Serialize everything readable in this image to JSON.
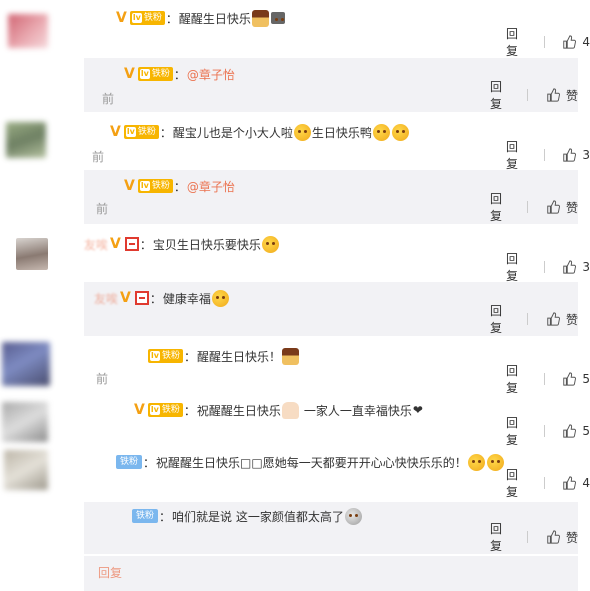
{
  "comments": [
    {
      "name": "",
      "badges": [
        "v",
        "fan"
      ],
      "fan_label": "铁粉",
      "text": "醒醒生日快乐",
      "emoji": [
        "cake-emoji",
        "family-emoji"
      ],
      "reply_label": "回复",
      "like_count": "4"
    },
    {
      "name": "",
      "badges": [
        "v",
        "fan"
      ],
      "fan_label": "铁粉",
      "mention": "@章子怡",
      "time": "前",
      "reply_label": "回复",
      "like_label": "赞"
    },
    {
      "name": "",
      "badges": [
        "v",
        "fan"
      ],
      "fan_label": "铁粉",
      "text": "醒宝儿也是个小大人啦",
      "text2": "生日快乐鸭",
      "time": "前",
      "reply_label": "回复",
      "like_count": "3"
    },
    {
      "name": "",
      "badges": [
        "v",
        "fan"
      ],
      "fan_label": "铁粉",
      "mention": "@章子怡",
      "time": "前",
      "reply_label": "回复",
      "like_label": "赞"
    },
    {
      "name": "友唉",
      "badges": [
        "v",
        "red"
      ],
      "text": "宝贝生日快乐要快乐",
      "reply_label": "回复",
      "like_count": "3"
    },
    {
      "name": "友唉",
      "badges": [
        "v",
        "red"
      ],
      "text": "健康幸福",
      "reply_label": "回复",
      "like_label": "赞"
    },
    {
      "name": "",
      "badges": [
        "fan"
      ],
      "fan_label": "铁粉",
      "text": "醒醒生日快乐！",
      "time": "前",
      "reply_label": "回复",
      "like_count": "5"
    },
    {
      "name": "",
      "badges": [
        "v",
        "fan"
      ],
      "fan_label": "铁粉",
      "text": "祝醒醒生日快乐",
      "text2": "一家人一直幸福快乐",
      "reply_label": "回复",
      "like_count": "5"
    },
    {
      "name": "",
      "badges": [
        "fan-blue"
      ],
      "fan_label": "铁粉",
      "text": "祝醒醒生日快乐□□愿她每一天都要开开心心快快乐乐的！",
      "reply_label": "回复",
      "like_count": "4"
    },
    {
      "name": "",
      "badges": [
        "fan-blue"
      ],
      "fan_label": "铁粉",
      "text": "咱们就是说 这一家颜值都太高了",
      "reply_label": "回复",
      "like_label": "赞"
    }
  ],
  "footer": {
    "reply_label": "回复"
  },
  "colors": {
    "accent": "#eb7350",
    "vip": "#f4a013",
    "fan": "#f7b500",
    "fan_blue": "#7bb7ee",
    "sub_bg": "#f2f2f5"
  }
}
